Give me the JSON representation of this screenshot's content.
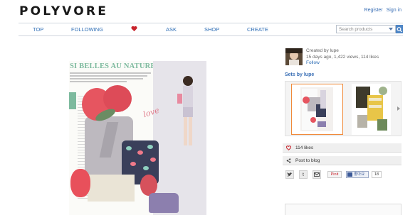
{
  "header": {
    "logo": "POLYVORE",
    "register": "Register",
    "signin": "Sign in"
  },
  "nav": {
    "items": [
      "TOP",
      "FOLLOWING",
      "ASK",
      "SHOP",
      "CREATE"
    ],
    "heart_icon": "heart-icon",
    "search_placeholder": "Search products"
  },
  "collage": {
    "magazine_title": "SI BELLES AU NATUREL",
    "love_text": "love"
  },
  "creator": {
    "line1": "Created by lupe",
    "line2": "15 days ago, 1,422 views, 114 likes",
    "follow": "Follow"
  },
  "sets": {
    "title": "Sets by lupe"
  },
  "actions": {
    "likes": "114 likes",
    "post": "Post to blog"
  },
  "share": {
    "twitter": "t",
    "tumblr": "t",
    "email": "@",
    "pinterest": "Pinit",
    "facebook": "좋아요",
    "fb_count": "18"
  },
  "colors": {
    "accent": "#2d6db5",
    "heart": "#c8232c",
    "magazine_green": "#7dba9e"
  }
}
